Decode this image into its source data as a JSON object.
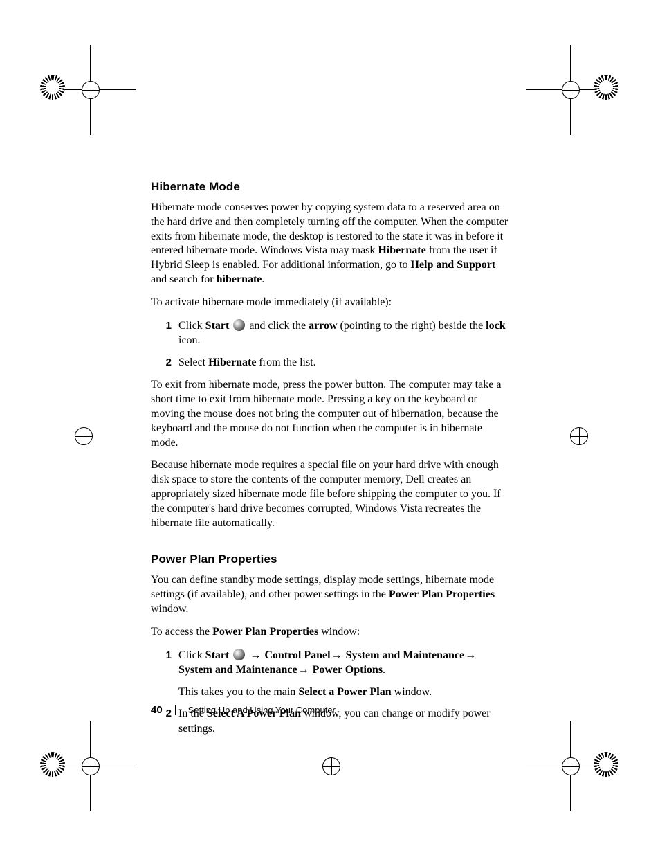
{
  "heading1": "Hibernate Mode",
  "p1_plain": "Hibernate mode conserves power by copying system data to a reserved area on the hard drive and then completely turning off the computer. When the computer exits from hibernate mode, the desktop is restored to the state it was in before it entered hibernate mode. Windows Vista may mask ",
  "p1_bold1": "Hibernate",
  "p1_mid": " from the user if Hybrid Sleep is enabled. For additional information, go to ",
  "p1_bold2": "Help and Support",
  "p1_mid2": " and search for ",
  "p1_bold3": "hibernate",
  "p1_end": ".",
  "p2": "To activate hibernate mode immediately (if available):",
  "s1_num": "1",
  "s1_a": "Click ",
  "s1_b_start": "Start",
  "s1_c": " and click the ",
  "s1_b_arrow": "arrow",
  "s1_d": " (pointing to the right) beside the ",
  "s1_b_lock": "lock",
  "s1_e": " icon.",
  "s2_num": "2",
  "s2_a": "Select ",
  "s2_b": "Hibernate",
  "s2_c": " from the list.",
  "p3": "To exit from hibernate mode, press the power button. The computer may take a short time to exit from hibernate mode. Pressing a key on the keyboard or moving the mouse does not bring the computer out of hibernation, because the keyboard and the mouse do not function when the computer is in hibernate mode.",
  "p4": "Because hibernate mode requires a special file on your hard drive with enough disk space to store the contents of the computer memory, Dell creates an appropriately sized hibernate mode file before shipping the computer to you. If the computer's hard drive becomes corrupted, Windows Vista recreates the hibernate file automatically.",
  "heading2": "Power Plan Properties",
  "p5_a": "You can define standby mode settings, display mode settings, hibernate mode settings (if available), and other power settings in the ",
  "p5_b": "Power Plan Properties",
  "p5_c": " window.",
  "p6_a": "To access the ",
  "p6_b": "Power Plan Properties",
  "p6_c": " window:",
  "s3_num": "1",
  "s3_a": "Click ",
  "s3_b_start": "Start",
  "s3_arrow": "→",
  "s3_cp": " Control Panel",
  "s3_sm": " System and Maintenance",
  "s3_po": " Power Options",
  "s3_dot": ".",
  "s3_sub_a": "This takes you to the main ",
  "s3_sub_b": "Select a Power Plan",
  "s3_sub_c": " window.",
  "s4_num": "2",
  "s4_a": "In the ",
  "s4_b": "Select A Power Plan",
  "s4_c": " window, you can change or modify power settings.",
  "footer_page": "40",
  "footer_title": "Setting Up and Using Your Computer"
}
